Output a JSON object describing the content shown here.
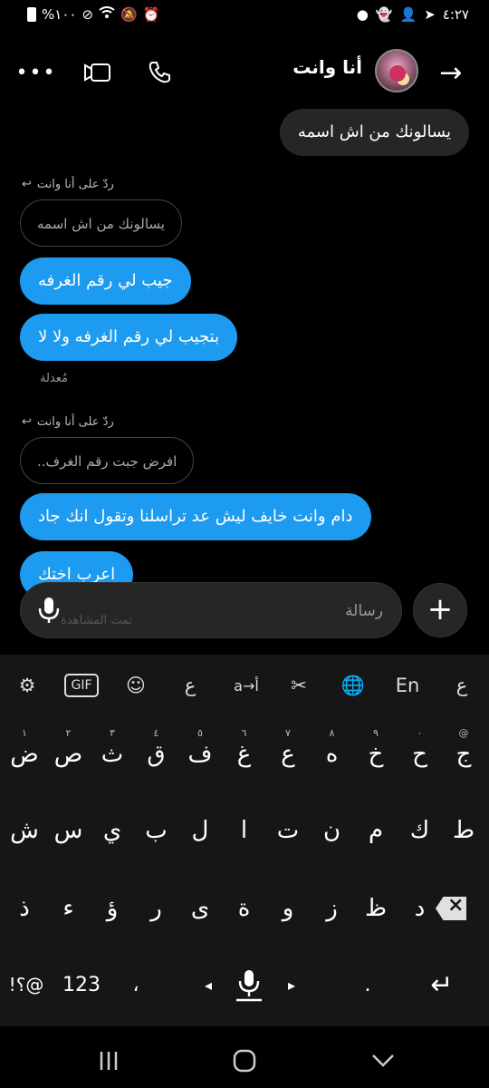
{
  "status_bar": {
    "time": "٤:٢٧",
    "battery": "%١٠٠",
    "icons": [
      "battery-icon",
      "dnd-icon",
      "wifi-icon",
      "mute-icon",
      "alarm-icon",
      "dot-icon",
      "snapchat-icon",
      "add-user-icon",
      "telegram-icon"
    ]
  },
  "header": {
    "title": "أنا وانت",
    "icons": [
      "more-icon",
      "video-icon",
      "phone-icon",
      "back-arrow-icon"
    ]
  },
  "messages": {
    "m1": "يسالونك من اش اسمه",
    "reply1_label": "ردّ على أنا وانت",
    "quote1": "يسالونك من اش اسمه",
    "m2": "جيب لي رقم الغرفه",
    "m3": "بتجيب لي رقم الغرفه ولا لا",
    "edited": "مُعدلة",
    "reply2_label": "ردّ على أنا وانت",
    "quote2": "افرض جبت رقم الغرف..",
    "m4": "دام وانت خايف ليش عد تراسلنا وتقول انك جاد",
    "m5": "اعرب اختك"
  },
  "composer": {
    "placeholder": "رسالة",
    "faded_text": "تمت المشاهدة"
  },
  "keyboard": {
    "toolbar": [
      "⚙",
      "GIF",
      "☺",
      "ع",
      "a→أ",
      "✂",
      "🌐",
      "En",
      "ع"
    ],
    "row1": [
      "ض",
      "ص",
      "ث",
      "ق",
      "ف",
      "غ",
      "ع",
      "ه",
      "خ",
      "ح",
      "ج"
    ],
    "row1_hints": [
      "١",
      "٢",
      "٣",
      "٤",
      "٥",
      "٦",
      "٧",
      "٨",
      "٩",
      "٠",
      "@"
    ],
    "row2": [
      "ش",
      "س",
      "ي",
      "ب",
      "ل",
      "ا",
      "ت",
      "ن",
      "م",
      "ك",
      "ط"
    ],
    "row3": [
      "ذ",
      "ء",
      "ؤ",
      "ر",
      "ى",
      "ة",
      "و",
      "ز",
      "ظ",
      "د"
    ],
    "row4": {
      "sym": "!؟@",
      "num": "123",
      "comma": "،",
      "left": "◂",
      "right": "▸",
      "dot": ".",
      "enter": "↵"
    }
  }
}
